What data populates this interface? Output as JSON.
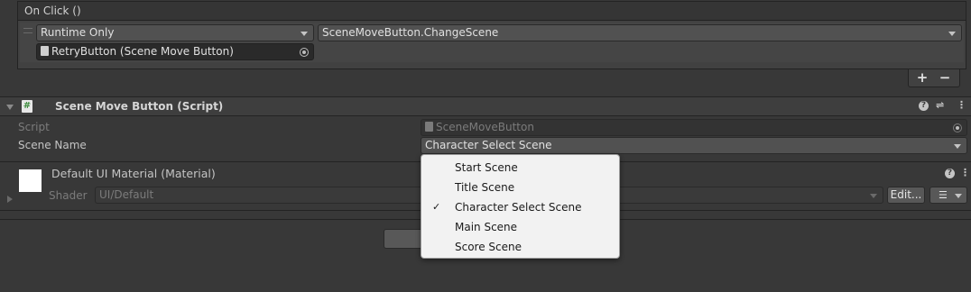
{
  "on_click": {
    "title": "On Click ()",
    "runtime_mode": "Runtime Only",
    "function": "SceneMoveButton.ChangeScene",
    "target_object": "RetryButton (Scene Move Button)",
    "add_label": "+",
    "remove_label": "−"
  },
  "component": {
    "title": "Scene Move Button (Script)",
    "script_label": "Script",
    "script_value": "SceneMoveButton",
    "scene_name_label": "Scene Name",
    "scene_name_value": "Character Select Scene"
  },
  "material": {
    "title": "Default UI Material (Material)",
    "shader_label": "Shader",
    "shader_value": "UI/Default",
    "edit_label": "Edit..."
  },
  "popup": {
    "selected": "Character Select Scene",
    "items": [
      "Start Scene",
      "Title Scene",
      "Character Select Scene",
      "Main Scene",
      "Score Scene"
    ]
  },
  "colors": {
    "background": "#383838",
    "popup_background": "#f2f2f2",
    "script_icon_accent": "#3a8a3a"
  },
  "icons": [
    "script-file-icon",
    "object-picker-icon",
    "help-icon",
    "preset-icon",
    "kebab-menu-icon",
    "foldout-arrow-icon",
    "checkmark-icon",
    "list-options-icon"
  ]
}
